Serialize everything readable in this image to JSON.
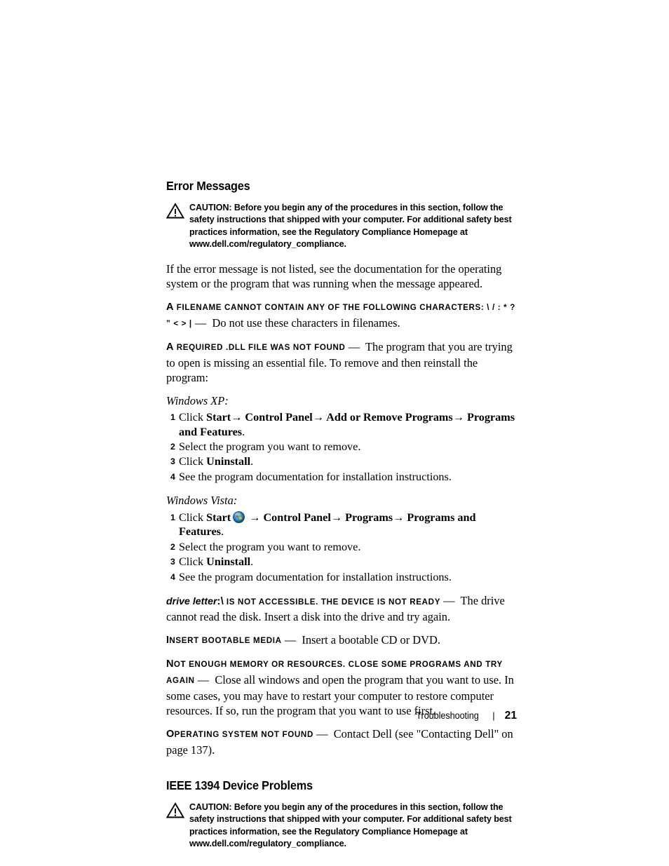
{
  "document": {
    "section1": {
      "heading": "Error Messages",
      "caution": {
        "icon": "warning-triangle-icon",
        "label": "CAUTION:",
        "text": "Before you begin any of the procedures in this section, follow the safety instructions that shipped with your computer. For additional safety best practices information, see the Regulatory Compliance Homepage at www.dell.com/regulatory_compliance."
      },
      "intro": "If the error message is not listed, see the documentation for the operating system or the program that was running when the message appeared.",
      "messages": [
        {
          "lead_cap": "A",
          "lead_rest": " filename cannot contain any of the following characters: \\ / : * ? ” < > |",
          "dash": "—",
          "body": "Do not use these characters in filenames."
        },
        {
          "lead_cap": "A",
          "lead_rest": " required .DLL file was not found",
          "dash": "—",
          "body": "The program that you are trying to open is missing an essential file. To remove and then reinstall the program:"
        }
      ],
      "xp": {
        "label": "Windows XP:",
        "steps": [
          {
            "num": "1",
            "text_parts": [
              "Click ",
              "Start",
              "→",
              " Control Panel",
              "→",
              " Add or Remove Programs",
              "→",
              " Programs and Features",
              "."
            ]
          },
          {
            "num": "2",
            "text": "Select the program you want to remove."
          },
          {
            "num": "3",
            "pre": "Click ",
            "bold": "Uninstall",
            "post": "."
          },
          {
            "num": "4",
            "text": "See the program documentation for installation instructions."
          }
        ]
      },
      "vista": {
        "label": "Windows Vista:",
        "steps": [
          {
            "num": "1",
            "pre": "Click ",
            "bold": "Start",
            "icon": "windows-vista-start-orb-icon",
            "post_parts": [
              " →",
              " Control Panel",
              "→",
              " Programs",
              "→",
              " Programs and Features",
              "."
            ]
          },
          {
            "num": "2",
            "text": "Select the program you want to remove."
          },
          {
            "num": "3",
            "pre": "Click ",
            "bold": "Uninstall",
            "post": "."
          },
          {
            "num": "4",
            "text": "See the program documentation for installation instructions."
          }
        ]
      },
      "messages2": [
        {
          "lead_italic": "drive letter",
          "lead_cap": ":\\",
          "lead_rest": " is not accessible. The device is not ready",
          "dash": "—",
          "body": "The drive cannot read the disk. Insert a disk into the drive and try again."
        },
        {
          "lead_cap": "I",
          "lead_rest": "nsert bootable media",
          "dash": "—",
          "body": "Insert a bootable CD or DVD."
        },
        {
          "lead_cap": "N",
          "lead_rest": "ot enough memory or resources. Close some programs and try again",
          "dash": "—",
          "body": "Close all windows and open the program that you want to use. In some cases, you may have to restart your computer to restore computer resources. If so, run the program that you want to use first."
        },
        {
          "lead_cap": "O",
          "lead_rest": "perating system not found",
          "dash": "—",
          "body": "Contact Dell (see \"Contacting Dell\" on page 137)."
        }
      ]
    },
    "section2": {
      "heading": "IEEE 1394 Device Problems",
      "caution": {
        "icon": "warning-triangle-icon",
        "label": "CAUTION:",
        "text": "Before you begin any of the procedures in this section, follow the safety instructions that shipped with your computer. For additional safety best practices information, see the Regulatory Compliance Homepage at www.dell.com/regulatory_compliance."
      }
    },
    "footer": {
      "label": "Troubleshooting",
      "separator": "|",
      "page_number": "21"
    }
  }
}
